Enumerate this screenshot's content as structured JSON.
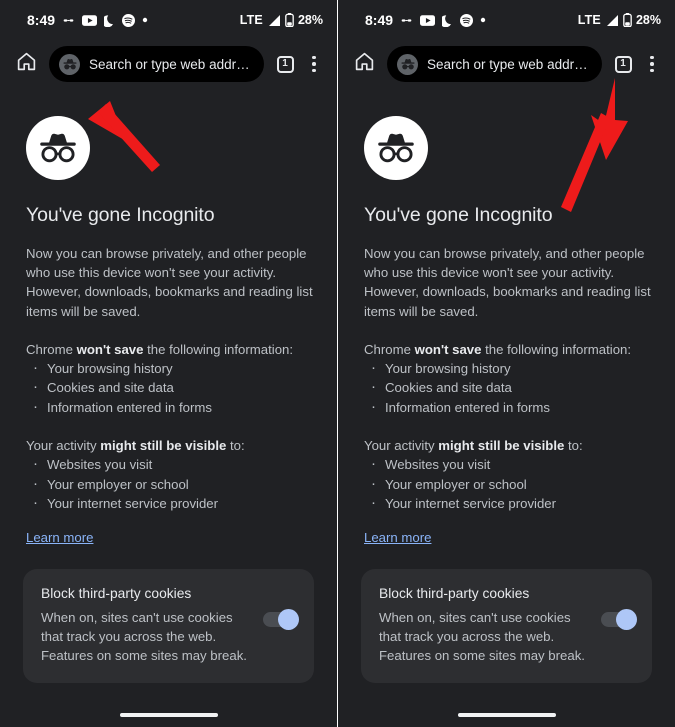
{
  "meta": {
    "screen_count": 2,
    "accent_link_color": "#8ab4f8",
    "background_color": "#202124",
    "card_color": "#2d2e31",
    "annotation_arrow_color": "#ee1b1b",
    "toggle_thumb_color": "#aec7f7",
    "toggle_track_color": "#4a4d52"
  },
  "status_bar": {
    "clock": "8:49",
    "icons_left": [
      "link-icon",
      "youtube-icon",
      "do-not-disturb-moon-icon",
      "spotify-icon",
      "dot-icon"
    ],
    "network_label": "LTE",
    "signal_icon": "signal-bars-icon",
    "battery_icon": "battery-icon",
    "battery_percent": "28%"
  },
  "toolbar": {
    "home_icon": "home-icon",
    "omnibox_placeholder": "Search or type web address",
    "omnibox_leading_icon": "incognito-icon",
    "tab_count": "1",
    "menu_icon": "overflow-menu-icon"
  },
  "page": {
    "logo_icon": "incognito-hat-glasses-icon",
    "title": "You've gone Incognito",
    "intro": "Now you can browse privately, and other people who use this device won't see your activity. However, downloads, bookmarks and reading list items will be saved.",
    "wont_save": {
      "head_before": "Chrome ",
      "head_bold": "won't save",
      "head_after": " the following information:",
      "items": [
        "Your browsing history",
        "Cookies and site data",
        "Information entered in forms"
      ]
    },
    "might_be_visible": {
      "head_before": "Your activity ",
      "head_bold": "might still be visible",
      "head_after": " to:",
      "items": [
        "Websites you visit",
        "Your employer or school",
        "Your internet service provider"
      ]
    },
    "learn_more_label": "Learn more",
    "cookie_card": {
      "title": "Block third-party cookies",
      "description": "When on, sites can't use cookies that track you across the web. Features on some sites may break.",
      "toggle_state": "on"
    }
  },
  "annotations": [
    {
      "name": "arrow-pointing-to-omnibox-incognito-icon",
      "target": "omnibox incognito badge"
    },
    {
      "name": "arrow-pointing-to-tab-switcher-button",
      "target": "tab switcher button"
    }
  ]
}
